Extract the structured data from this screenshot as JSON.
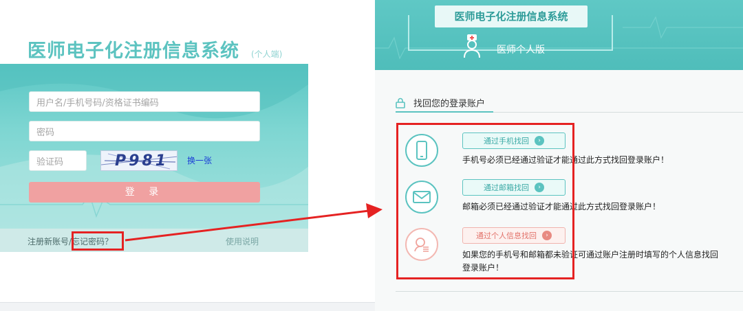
{
  "login": {
    "title": "医师电子化注册信息系统",
    "subtitle": "(个人端)",
    "username_placeholder": "用户名/手机号码/资格证书编码",
    "password_placeholder": "密码",
    "captcha_placeholder": "验证码",
    "captcha_text": "P981",
    "change_captcha": "换一张",
    "login_button": "登 录",
    "register_link": "注册新账号/",
    "forgot_link": "忘记密码？",
    "help_link": "使用说明"
  },
  "recovery": {
    "title": "医师电子化注册信息系统",
    "version": "医师个人版",
    "section_title": "找回您的登录账户",
    "options": [
      {
        "icon": "phone-icon",
        "button": "通过手机找回",
        "desc": "手机号必须已经通过验证才能通过此方式找回登录账户！"
      },
      {
        "icon": "mail-icon",
        "button": "通过邮箱找回",
        "desc": "邮箱必须已经通过验证才能通过此方式找回登录账户！"
      },
      {
        "icon": "personal-info-icon",
        "button": "通过个人信息找回",
        "desc_line1": "如果您的手机号和邮箱都未验证可通过账户注册时填写的个人信息找回",
        "desc_line2": "登录账户！"
      }
    ]
  },
  "colors": {
    "teal": "#5bc3c0",
    "pink": "#f0a1a1",
    "highlight": "#e52222"
  }
}
